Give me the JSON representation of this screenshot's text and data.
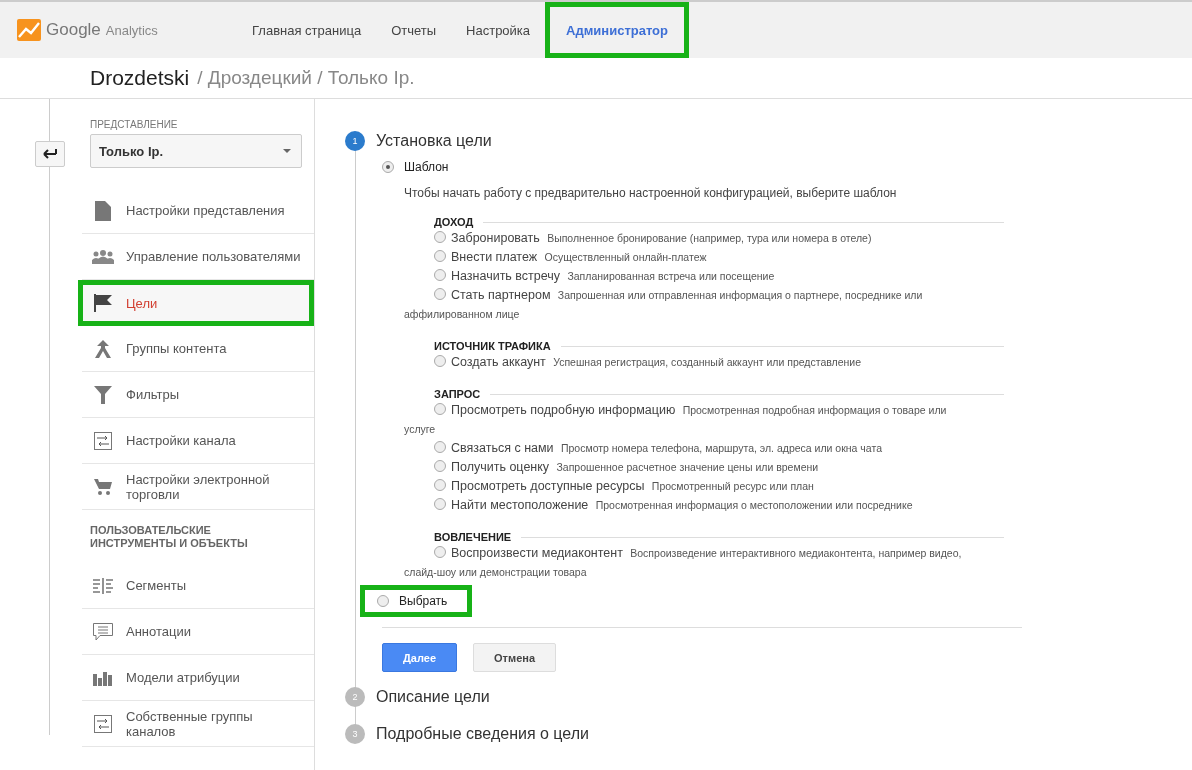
{
  "header": {
    "logo": {
      "brand": "Google",
      "product": "Analytics"
    },
    "nav": [
      {
        "label": "Главная страница",
        "selected": false,
        "highlighted": false
      },
      {
        "label": "Отчеты",
        "selected": false,
        "highlighted": false
      },
      {
        "label": "Настройка",
        "selected": false,
        "highlighted": false
      },
      {
        "label": "Администратор",
        "selected": true,
        "highlighted": true
      }
    ]
  },
  "breadcrumb": {
    "account": "Drozdetski",
    "path": "/ Дроздецкий / Только Ip."
  },
  "sidebar": {
    "view_label": "ПРЕДСТАВЛЕНИЕ",
    "view_value": "Только Ip.",
    "items": [
      {
        "kind": "document",
        "label": "Настройки представления",
        "selected": false,
        "highlighted": false
      },
      {
        "kind": "people",
        "label": "Управление пользователями",
        "selected": false,
        "highlighted": false
      },
      {
        "kind": "flag",
        "label": "Цели",
        "selected": true,
        "highlighted": true
      },
      {
        "kind": "merge",
        "label": "Группы контента",
        "selected": false,
        "highlighted": false
      },
      {
        "kind": "filter",
        "label": "Фильтры",
        "selected": false,
        "highlighted": false
      },
      {
        "kind": "channel",
        "label": "Настройки канала",
        "selected": false,
        "highlighted": false
      },
      {
        "kind": "cart",
        "label": "Настройки электронной торговли",
        "selected": false,
        "highlighted": false
      }
    ],
    "section_heading": "ПОЛЬЗОВАТЕЛЬСКИЕ ИНСТРУМЕНТЫ И ОБЪЕКТЫ",
    "section_items": [
      {
        "kind": "segments",
        "label": "Сегменты",
        "selected": false,
        "highlighted": false
      },
      {
        "kind": "annotation",
        "label": "Аннотации",
        "selected": false,
        "highlighted": false
      },
      {
        "kind": "bars",
        "label": "Модели атрибуции",
        "selected": false,
        "highlighted": false
      },
      {
        "kind": "channel",
        "label": "Собственные группы каналов",
        "selected": false,
        "highlighted": false
      }
    ]
  },
  "steps": [
    {
      "number": "1",
      "title": "Установка цели",
      "active": true
    },
    {
      "number": "2",
      "title": "Описание цели",
      "active": false
    },
    {
      "number": "3",
      "title": "Подробные сведения о цели",
      "active": false
    }
  ],
  "goal_setup": {
    "template_option": {
      "label": "Шаблон",
      "selected": true,
      "highlighted": false
    },
    "hint": "Чтобы начать работу с предварительно настроенной конфигурацией, выберите шаблон",
    "groups": [
      {
        "heading": "ДОХОД",
        "goals": [
          {
            "name": "Забронировать",
            "description": "Выполненное бронирование (например, тура или номера в отеле)",
            "selected": false
          },
          {
            "name": "Внести платеж",
            "description": "Осуществленный онлайн-платеж",
            "selected": false
          },
          {
            "name": "Назначить встречу",
            "description": "Запланированная встреча или посещение",
            "selected": false
          },
          {
            "name": "Стать партнером",
            "description": "Запрошенная или отправленная информация о партнере, посреднике или аффилированном лице",
            "selected": false
          }
        ]
      },
      {
        "heading": "ИСТОЧНИК ТРАФИКА",
        "goals": [
          {
            "name": "Создать аккаунт",
            "description": "Успешная регистрация, созданный аккаунт или представление",
            "selected": false
          }
        ]
      },
      {
        "heading": "ЗАПРОС",
        "goals": [
          {
            "name": "Просмотреть подробную информацию",
            "description": "Просмотренная подробная информация о товаре или услуге",
            "selected": false
          },
          {
            "name": "Связаться с нами",
            "description": "Просмотр номера телефона, маршрута, эл. адреса или окна чата",
            "selected": false
          },
          {
            "name": "Получить оценку",
            "description": "Запрошенное расчетное значение цены или времени",
            "selected": false
          },
          {
            "name": "Просмотреть доступные ресурсы",
            "description": "Просмотренный ресурс или план",
            "selected": false
          },
          {
            "name": "Найти местоположение",
            "description": "Просмотренная информация о местоположении или посреднике",
            "selected": false
          }
        ]
      },
      {
        "heading": "ВОВЛЕЧЕНИЕ",
        "goals": [
          {
            "name": "Воспроизвести медиаконтент",
            "description": "Воспроизведение интерактивного медиаконтента, например видео, слайд-шоу или демонстрации товара",
            "selected": false
          }
        ]
      }
    ],
    "custom_option": {
      "label": "Выбрать",
      "selected": false,
      "highlighted": true
    },
    "buttons": [
      {
        "kind": "primary",
        "label": "Далее"
      },
      {
        "kind": "secondary",
        "label": "Отмена"
      }
    ]
  }
}
